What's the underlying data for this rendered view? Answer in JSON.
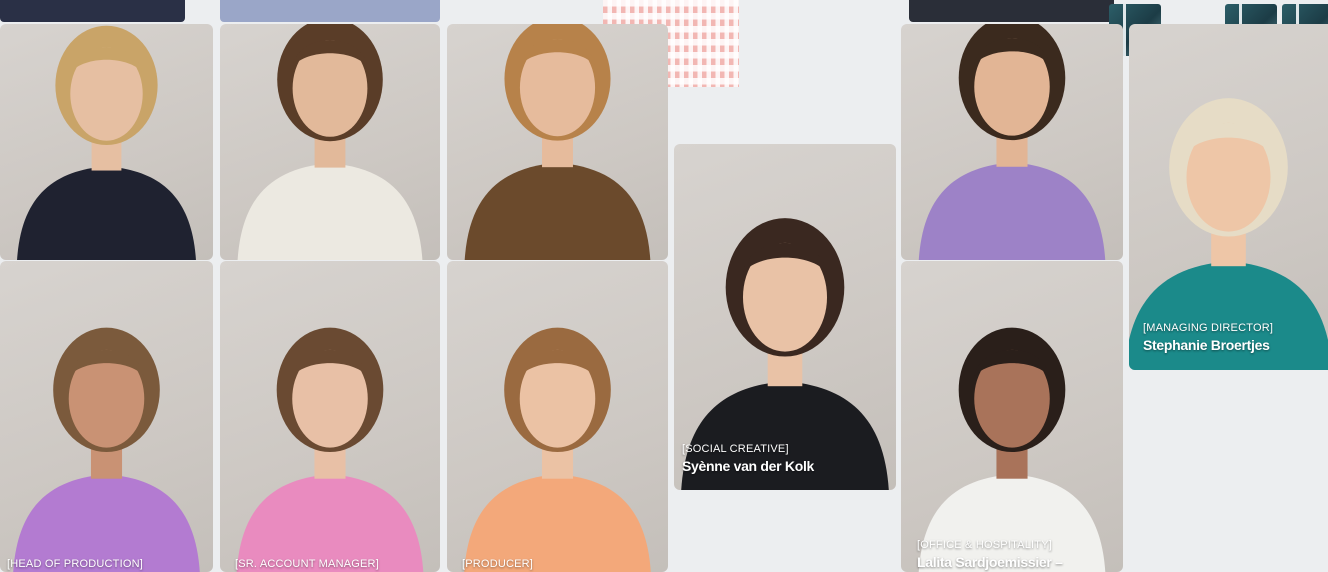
{
  "team": [
    {
      "id": "p1",
      "role": "",
      "name": "",
      "colors": {
        "hair": "#c9a468",
        "skin": "#e6bfa2",
        "top": "#1f2230"
      }
    },
    {
      "id": "p2",
      "role": "",
      "name": "",
      "colors": {
        "hair": "#5a3d28",
        "skin": "#e2b99a",
        "top": "#ece9e1"
      }
    },
    {
      "id": "p3",
      "role": "",
      "name": "",
      "colors": {
        "hair": "#b7824a",
        "skin": "#e6bb9c",
        "top": "#6b4a2c"
      }
    },
    {
      "id": "p4",
      "role": "[SOCIAL CREATIVE]",
      "name": "Syènne van der Kolk",
      "colors": {
        "hair": "#3a2820",
        "skin": "#e9c2a6",
        "top": "#1b1c20"
      }
    },
    {
      "id": "p5",
      "role": "",
      "name": "",
      "colors": {
        "hair": "#3b2a1e",
        "skin": "#e2b595",
        "top": "#9d82c7"
      }
    },
    {
      "id": "p6",
      "role": "[MANAGING DIRECTOR]",
      "name": "Stephanie Broertjes",
      "colors": {
        "hair": "#e6dcc6",
        "skin": "#eec6a7",
        "top": "#1b8a8a"
      }
    },
    {
      "id": "p7",
      "role": "[HEAD OF PRODUCTION]",
      "name": "",
      "colors": {
        "hair": "#7b5a3c",
        "skin": "#c99274",
        "top": "#b37bd1"
      }
    },
    {
      "id": "p8",
      "role": "[SR. ACCOUNT MANAGER]",
      "name": "",
      "colors": {
        "hair": "#6a4a32",
        "skin": "#e8c0a6",
        "top": "#e98bbf"
      }
    },
    {
      "id": "p9",
      "role": "[PRODUCER]",
      "name": "",
      "colors": {
        "hair": "#9a6a40",
        "skin": "#ebc2a4",
        "top": "#f3a87a"
      }
    },
    {
      "id": "p10",
      "role": "[OFFICE & HOSPITALITY]",
      "name": "Lalita Sardjoemissier –",
      "colors": {
        "hair": "#2a1f1a",
        "skin": "#a9735a",
        "top": "#f1f1ee"
      }
    }
  ],
  "accents": {
    "background": "#eceef0",
    "qr": "#f2b7b3",
    "icon": "#1f4750"
  }
}
